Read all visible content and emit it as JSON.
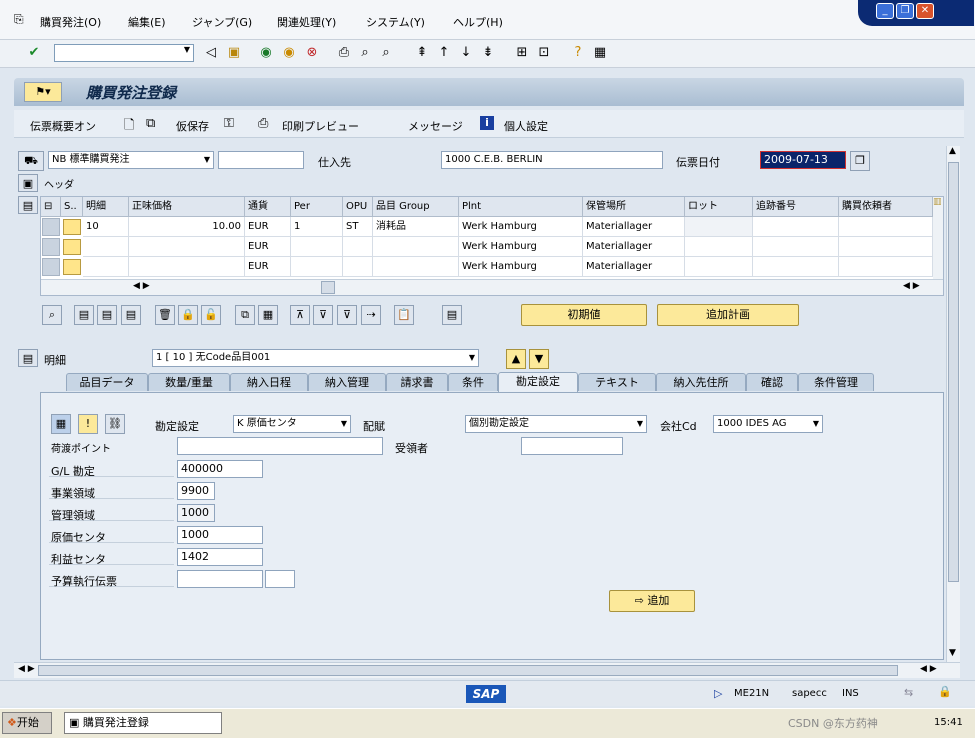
{
  "menu": {
    "items": [
      "購買発注(O)",
      "編集(E)",
      "ジャンプ(G)",
      "関連処理(Y)",
      "システム(Y)",
      "ヘルプ(H)"
    ]
  },
  "window": {
    "min": "_",
    "restore": "❐",
    "close": "✕"
  },
  "title": "購買発注登録",
  "app_toolbar": {
    "doc_overview": "伝票概要オン",
    "hold": "仮保存",
    "print_preview": "印刷プレビュー",
    "messages": "メッセージ",
    "personal": "個人設定"
  },
  "header": {
    "doc_type": "NB 標準購買発注",
    "vendor_label": "仕入先",
    "vendor": "1000 C.E.B. BERLIN",
    "doc_date_label": "伝票日付",
    "doc_date": "2009-07-13",
    "header_label": "ヘッダ"
  },
  "grid": {
    "columns": [
      "S..",
      "明細",
      "正味価格",
      "通貨",
      "Per",
      "OPU",
      "品目 Group",
      "Plnt",
      "保管場所",
      "ロット",
      "追跡番号",
      "購買依頼者"
    ],
    "rows": [
      {
        "item": "10",
        "price": "10.00",
        "curr": "EUR",
        "per": "1",
        "opu": "ST",
        "group": "消耗品",
        "plnt": "Werk Hamburg",
        "sloc": "Materiallager"
      },
      {
        "item": "",
        "price": "",
        "curr": "EUR",
        "per": "",
        "opu": "",
        "group": "",
        "plnt": "Werk Hamburg",
        "sloc": "Materiallager"
      },
      {
        "item": "",
        "price": "",
        "curr": "EUR",
        "per": "",
        "opu": "",
        "group": "",
        "plnt": "Werk Hamburg",
        "sloc": "Materiallager"
      }
    ]
  },
  "buttons": {
    "default_values": "初期値",
    "add_plan": "追加計画",
    "add": "追加"
  },
  "detail": {
    "label": "明細",
    "item_select": "1 [ 10 ] 无Code品目001"
  },
  "tabs": [
    "品目データ",
    "数量/重量",
    "納入日程",
    "納入管理",
    "請求書",
    "条件",
    "勘定設定",
    "テキスト",
    "納入先住所",
    "確認",
    "条件管理"
  ],
  "account": {
    "assign_label": "勘定設定",
    "assign_value": "K 原価センタ",
    "distrib_label": "配賦",
    "distrib_value": "個別勘定設定",
    "company_label": "会社Cd",
    "company_value": "1000 IDES AG",
    "unloading_label": "荷渡ポイント",
    "recipient_label": "受領者",
    "gl_label": "G/L 勘定",
    "gl": "400000",
    "ba_label": "事業領域",
    "ba": "9900",
    "ca_label": "管理領域",
    "ca": "1000",
    "cc_label": "原価センタ",
    "cc": "1000",
    "pc_label": "利益センタ",
    "pc": "1402",
    "fund_label": "予算執行伝票"
  },
  "status": {
    "sap": "SAP",
    "tcode": "ME21N",
    "server": "sapecc",
    "mode": "INS"
  },
  "taskbar": {
    "start": "开始",
    "task": "購買発注登録",
    "clock": "15:41",
    "watermark": "CSDN @东方药神"
  }
}
